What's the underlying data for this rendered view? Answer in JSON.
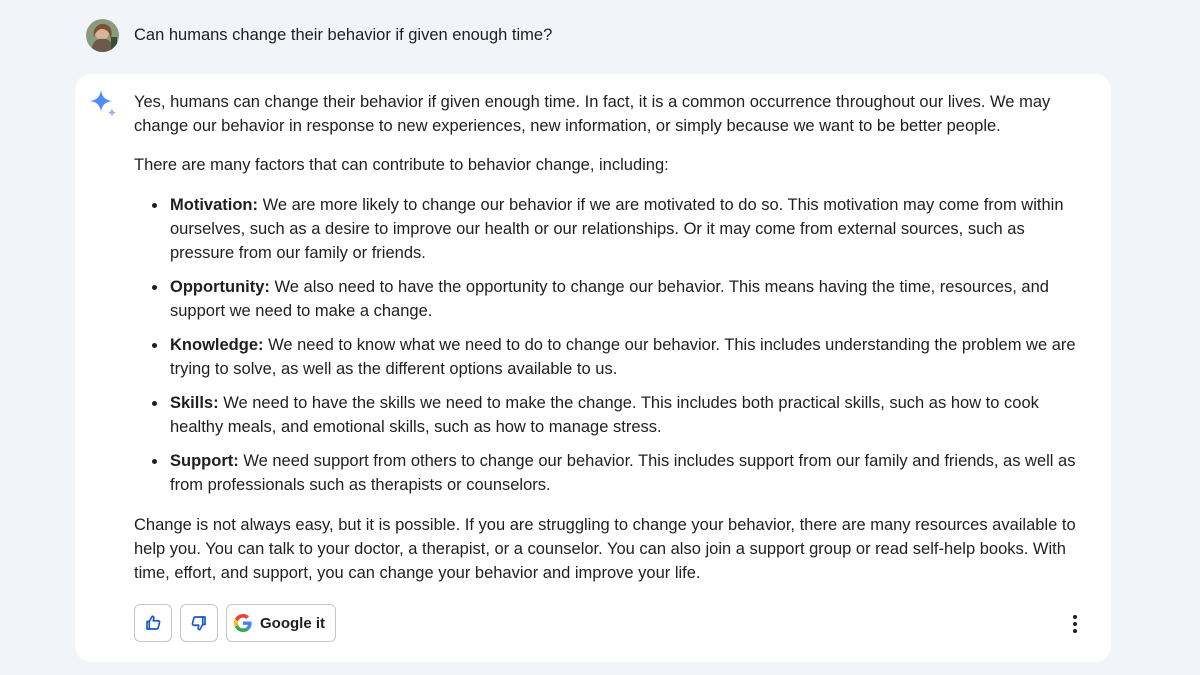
{
  "user": {
    "prompt": "Can humans change their behavior if given enough time?"
  },
  "response": {
    "intro": "Yes, humans can change their behavior if given enough time. In fact, it is a common occurrence throughout our lives. We may change our behavior in response to new experiences, new information, or simply because we want to be better people.",
    "factors_lead": "There are many factors that can contribute to behavior change, including:",
    "factors": [
      {
        "term": "Motivation:",
        "text": " We are more likely to change our behavior if we are motivated to do so. This motivation may come from within ourselves, such as a desire to improve our health or our relationships. Or it may come from external sources, such as pressure from our family or friends."
      },
      {
        "term": "Opportunity:",
        "text": " We also need to have the opportunity to change our behavior. This means having the time, resources, and support we need to make a change."
      },
      {
        "term": "Knowledge:",
        "text": " We need to know what we need to do to change our behavior. This includes understanding the problem we are trying to solve, as well as the different options available to us."
      },
      {
        "term": "Skills:",
        "text": " We need to have the skills we need to make the change. This includes both practical skills, such as how to cook healthy meals, and emotional skills, such as how to manage stress."
      },
      {
        "term": "Support:",
        "text": " We need support from others to change our behavior. This includes support from our family and friends, as well as from professionals such as therapists or counselors."
      }
    ],
    "closing": "Change is not always easy, but it is possible. If you are struggling to change your behavior, there are many resources available to help you. You can talk to your doctor, a therapist, or a counselor. You can also join a support group or read self-help books. With time, effort, and support, you can change your behavior and improve your life."
  },
  "actions": {
    "thumbs_up_icon": "thumbs-up-icon",
    "thumbs_down_icon": "thumbs-down-icon",
    "google_it_label": "Google it",
    "more_icon": "more-vertical-icon"
  },
  "colors": {
    "page_bg": "#f1f4f9",
    "card_bg": "#ffffff",
    "text": "#1f1f1f",
    "sparkle_blue": "#4285f4",
    "border": "#c4c7c5"
  }
}
